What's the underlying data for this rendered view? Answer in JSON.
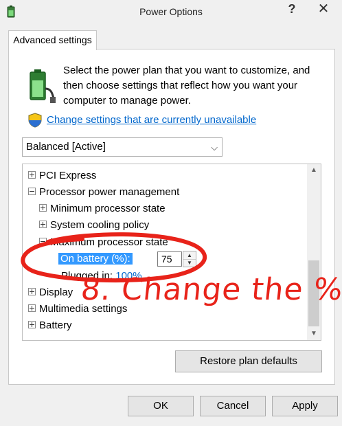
{
  "window": {
    "title": "Power Options",
    "help_glyph": "?",
    "close_glyph": "✕"
  },
  "tab": {
    "label": "Advanced settings"
  },
  "intro": {
    "text": "Select the power plan that you want to customize, and then choose settings that reflect how you want your computer to manage power."
  },
  "change_link": "Change settings that are currently unavailable",
  "plan": {
    "selected": "Balanced [Active]"
  },
  "tree": {
    "pci_express": "PCI Express",
    "processor_pm": "Processor power management",
    "min_state": "Minimum processor state",
    "cooling": "System cooling policy",
    "max_state": "Maximum processor state",
    "on_battery_label": "On battery (%):",
    "on_battery_value": "75",
    "plugged_label": "Plugged in:",
    "plugged_value": "100%",
    "display": "Display",
    "multimedia": "Multimedia settings",
    "battery": "Battery"
  },
  "buttons": {
    "restore": "Restore plan defaults",
    "ok": "OK",
    "cancel": "Cancel",
    "apply": "Apply"
  },
  "annotation": {
    "text": "8. Change the %",
    "color": "#e8231a"
  },
  "icons": {
    "app": "power-options-icon",
    "battery": "battery-plug-icon",
    "shield": "uac-shield-icon"
  }
}
